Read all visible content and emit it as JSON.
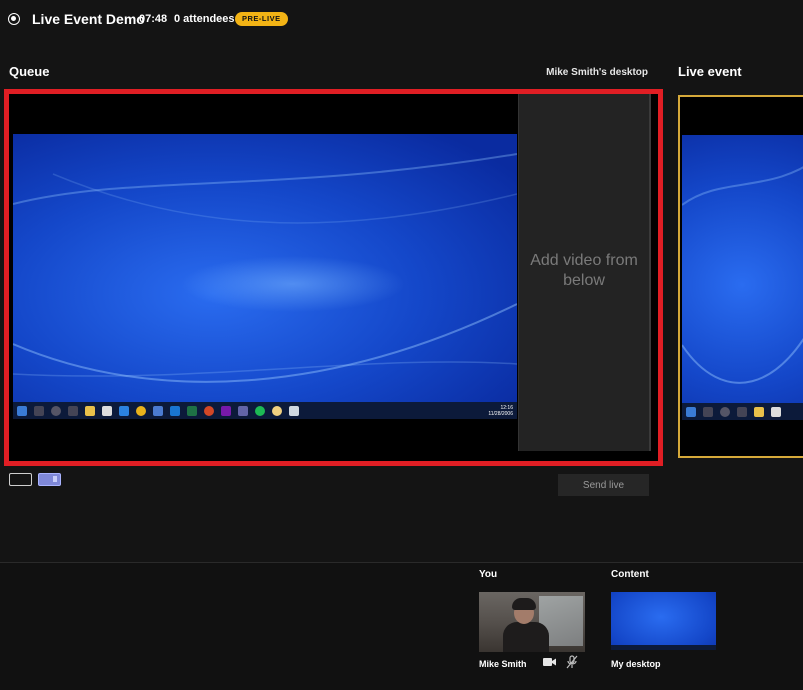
{
  "header": {
    "event_title": "Live Event Demo",
    "timer": "07:48",
    "attendees": "0 attendees",
    "status_badge": "PRE-LIVE"
  },
  "queue": {
    "label": "Queue",
    "source_label": "Mike Smith's desktop",
    "add_video_text": "Add video from below",
    "send_live_label": "Send live",
    "clock_time": "12:16",
    "clock_date": "11/28/2006"
  },
  "live_event": {
    "label": "Live event"
  },
  "sources": {
    "you_label": "You",
    "you_name": "Mike Smith",
    "content_label": "Content",
    "content_name": "My desktop"
  },
  "colors": {
    "queue_border": "#e01e24",
    "live_border": "#d6a93a",
    "badge_bg": "#f2b315",
    "layout_selected": "#7f88d8"
  },
  "icons": [
    "record-icon",
    "camera-icon",
    "mic-off-icon",
    "layout-single-icon",
    "layout-split-icon"
  ]
}
